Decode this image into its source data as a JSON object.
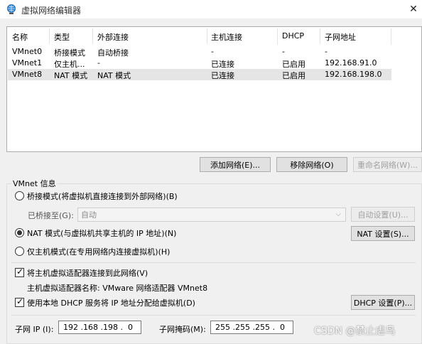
{
  "window": {
    "title": "虚拟网络编辑器"
  },
  "network_table": {
    "columns": [
      "名称",
      "类型",
      "外部连接",
      "主机连接",
      "DHCP",
      "子网地址"
    ],
    "rows": [
      {
        "name": "VMnet0",
        "type": "桥接模式",
        "external": "自动桥接",
        "host": "-",
        "dhcp": "-",
        "subnet": "-",
        "selected": false
      },
      {
        "name": "VMnet1",
        "type": "仅主机...",
        "external": "-",
        "host": "已连接",
        "dhcp": "已启用",
        "subnet": "192.168.91.0",
        "selected": false
      },
      {
        "name": "VMnet8",
        "type": "NAT 模式",
        "external": "NAT 模式",
        "host": "已连接",
        "dhcp": "已启用",
        "subnet": "192.168.198.0",
        "selected": true
      }
    ]
  },
  "list_buttons": {
    "add": "添加网络(E)...",
    "remove": "移除网络(O)",
    "rename": "重命名网络(W)..."
  },
  "vmnet_info": {
    "title": "VMnet 信息",
    "bridged_label": "桥接模式(将虚拟机直接连接到外部网络)(B)",
    "bridged_to_label": "已桥接至(G):",
    "bridged_to_value": "自动",
    "auto_settings": "自动设置(U)...",
    "nat_label": "NAT 模式(与虚拟机共享主机的 IP 地址)(N)",
    "nat_settings": "NAT 设置(S)...",
    "host_only_label": "仅主机模式(在专用网络内连接虚拟机)(H)",
    "selected_mode": "nat",
    "connect_adapter_label": "将主机虚拟适配器连接到此网络(V)",
    "connect_adapter_checked": true,
    "adapter_name_text": "主机虚拟适配器名称: VMware 网络适配器 VMnet8",
    "dhcp_label": "使用本地 DHCP 服务将 IP 地址分配给虚拟机(D)",
    "dhcp_checked": true,
    "dhcp_settings": "DHCP 设置(P)...",
    "subnet_ip_label": "子网 IP (I):",
    "subnet_ip_value": "192 .168 .198 .  0",
    "subnet_mask_label": "子网掩码(M):",
    "subnet_mask_value": "255 .255 .255 .  0"
  },
  "watermark": "CSDN @禁止虐鸟"
}
